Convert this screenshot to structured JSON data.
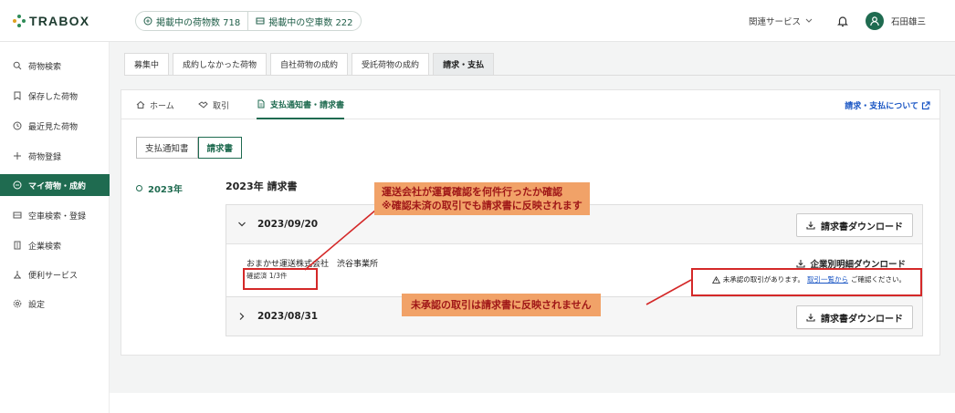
{
  "header": {
    "logo_text": "TRABOX",
    "cargo_count_label": "掲載中の荷物数 718",
    "truck_count_label": "掲載中の空車数 222",
    "related_services": "関連サービス",
    "user_name": "石田雄三"
  },
  "sidebar": {
    "items": [
      {
        "label": "荷物検索",
        "icon": "search-icon"
      },
      {
        "label": "保存した荷物",
        "icon": "bookmark-icon"
      },
      {
        "label": "最近見た荷物",
        "icon": "clock-icon"
      },
      {
        "label": "荷物登録",
        "icon": "plus-icon"
      },
      {
        "label": "マイ荷物・成約",
        "icon": "box-icon"
      },
      {
        "label": "空車検索・登録",
        "icon": "truck-icon"
      },
      {
        "label": "企業検索",
        "icon": "building-icon"
      },
      {
        "label": "便利サービス",
        "icon": "tools-icon"
      },
      {
        "label": "設定",
        "icon": "gear-icon"
      }
    ],
    "active_index": 4
  },
  "tabs": [
    "募集中",
    "成約しなかった荷物",
    "自社荷物の成約",
    "受託荷物の成約",
    "請求・支払"
  ],
  "active_tab": "請求・支払",
  "subnav": {
    "home": "ホーム",
    "deals": "取引",
    "statements": "支払通知書・請求書",
    "help": "請求・支払について"
  },
  "segment": {
    "payment_notice": "支払通知書",
    "invoice": "請求書"
  },
  "year_nav": "2023年",
  "year_title": "2023年 請求書",
  "invoices": [
    {
      "date": "2023/09/20",
      "download_label": "請求書ダウンロード",
      "company": "おまかせ運送株式会社　渋谷事業所",
      "confirmed": "確認済 1/3件",
      "detail_download": "企業別明細ダウンロード",
      "warning_prefix": "未承認の取引があります。",
      "warning_link": "取引一覧から",
      "warning_suffix": "ご確認ください。"
    },
    {
      "date": "2023/08/31",
      "download_label": "請求書ダウンロード"
    }
  ],
  "annotations": {
    "callout1_line1": "運送会社が運賃確認を何件行ったか確認",
    "callout1_line2": "※確認未済の取引でも請求書に反映されます",
    "callout2": "未承認の取引は請求書に反映されません"
  },
  "colors": {
    "brand": "#1f6b50",
    "link": "#1a56c4",
    "annotation_red": "#d42828",
    "callout_bg": "#f1a268"
  }
}
